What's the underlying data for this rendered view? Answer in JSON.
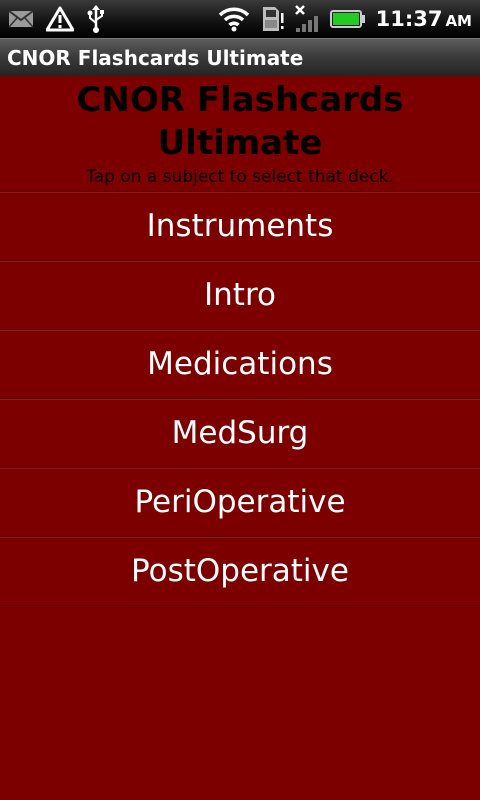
{
  "status_bar": {
    "icons_left": [
      "gmail-icon",
      "warning-icon",
      "usb-icon"
    ],
    "icons_right": [
      "wifi-icon",
      "sd-card-icon",
      "no-signal-icon",
      "battery-icon"
    ],
    "time": "11:37",
    "ampm": "AM"
  },
  "title_bar": {
    "title": "CNOR Flashcards Ultimate"
  },
  "header": {
    "title_line1": "CNOR Flashcards",
    "title_line2": "Ultimate",
    "subtitle": "Tap on a subject to select that deck."
  },
  "decks": [
    {
      "label": "Instruments"
    },
    {
      "label": "Intro"
    },
    {
      "label": "Medications"
    },
    {
      "label": "MedSurg"
    },
    {
      "label": "PeriOperative"
    },
    {
      "label": "PostOperative"
    }
  ],
  "colors": {
    "background": "#7d0000",
    "divider": "#5a0000",
    "battery_fill": "#22cc22"
  }
}
